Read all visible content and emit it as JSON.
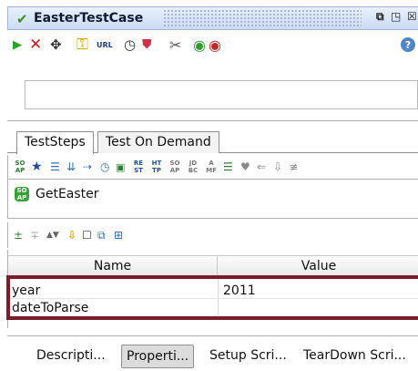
{
  "window": {
    "title": "EasterTestCase",
    "title_icon": "checkmark-icon",
    "controls": [
      "restore-icon",
      "maximize-icon",
      "close-icon"
    ]
  },
  "toolbar": {
    "url_label": "URL",
    "icons": [
      "run-icon",
      "cancel-icon",
      "options-icon",
      "key-icon",
      "url-icon",
      "clock-icon",
      "shield-icon",
      "tools-icon",
      "soapui-start-icon",
      "soapui-stop-icon",
      "help-icon"
    ]
  },
  "description": {
    "value": ""
  },
  "tabs": [
    {
      "label": "TestSteps",
      "active": true
    },
    {
      "label": "Test On Demand",
      "active": false
    }
  ],
  "steps_toolbar": {
    "icons": [
      "soap-request-icon",
      "star-icon",
      "list-icon",
      "import-icon",
      "transfer-icon",
      "delay-icon",
      "script-icon",
      "rest-icon",
      "http-icon",
      "soap-icon",
      "jdbc-icon",
      "amf-icon",
      "goto-icon",
      "mock-icon",
      "forward-icon",
      "download-icon",
      "manual-icon"
    ],
    "labels": [
      "SO AP",
      "RE ST",
      "HT TP",
      "SO AP",
      "JD BC",
      "A MF"
    ]
  },
  "test_steps": [
    {
      "label": "GetEaster",
      "icon": "soap-step-icon",
      "icon_text": "SO AP"
    }
  ],
  "properties_toolbar": {
    "icons": [
      "add-property-icon",
      "remove-property-icon",
      "move-up-icon",
      "move-down-icon",
      "sort-icon",
      "clear-icon",
      "load-icon",
      "save-icon"
    ]
  },
  "properties_table": {
    "columns": [
      "Name",
      "Value"
    ],
    "rows": [
      {
        "name": "year",
        "value": "2011"
      },
      {
        "name": "dateToParse",
        "value": ""
      }
    ]
  },
  "bottom_tabs": [
    {
      "label": "Descripti...",
      "active": false
    },
    {
      "label": "Properti...",
      "active": true
    },
    {
      "label": "Setup Scri...",
      "active": false
    },
    {
      "label": "TearDown Scri...",
      "active": false
    }
  ],
  "colors": {
    "highlight_border": "#7b1c2d",
    "title_bar": "#cddcf2",
    "run": "#27a327",
    "cancel": "#d21b1b"
  }
}
